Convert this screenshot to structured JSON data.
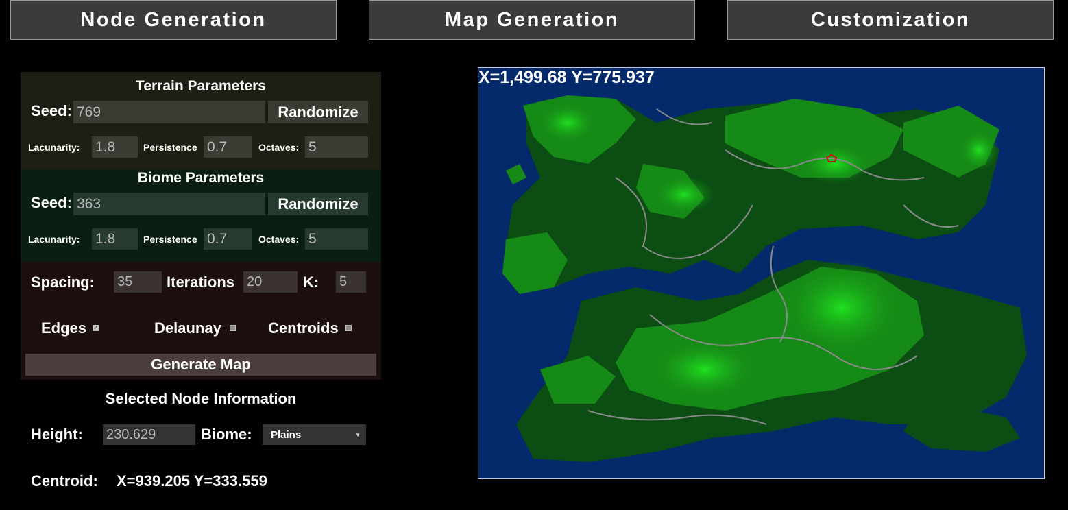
{
  "tabs": [
    "Node Generation",
    "Map Generation",
    "Customization"
  ],
  "terrain": {
    "title": "Terrain Parameters",
    "seed_label": "Seed:",
    "seed": "769",
    "randomize_label": "Randomize",
    "lacunarity_label": "Lacunarity:",
    "lacunarity": "1.8",
    "persistence_label": "Persistence",
    "persistence": "0.7",
    "octaves_label": "Octaves:",
    "octaves": "5"
  },
  "biome": {
    "title": "Biome Parameters",
    "seed_label": "Seed:",
    "seed": "363",
    "randomize_label": "Randomize",
    "lacunarity_label": "Lacunarity:",
    "lacunarity": "1.8",
    "persistence_label": "Persistence",
    "persistence": "0.7",
    "octaves_label": "Octaves:",
    "octaves": "5"
  },
  "generation": {
    "spacing_label": "Spacing:",
    "spacing": "35",
    "iterations_label": "Iterations",
    "iterations": "20",
    "k_label": "K:",
    "k": "5",
    "edges_label": "Edges",
    "edges_checked": true,
    "delaunay_label": "Delaunay",
    "delaunay_checked": false,
    "centroids_label": "Centroids",
    "centroids_checked": false,
    "generate_label": "Generate Map"
  },
  "selected_node": {
    "title": "Selected Node Information",
    "height_label": "Height:",
    "height": "230.629",
    "biome_label": "Biome:",
    "biome": "Plains",
    "centroid_label": "Centroid:",
    "centroid": "X=939.205 Y=333.559"
  },
  "map": {
    "cursor_coord": "X=1,499.68 Y=775.937",
    "colors": {
      "ocean": "#052a6b",
      "forest": "#0b4d12",
      "grass": "#168a16",
      "highland": "#18c818",
      "ridge": "#8a8a8a",
      "selection": "#d01010"
    }
  }
}
